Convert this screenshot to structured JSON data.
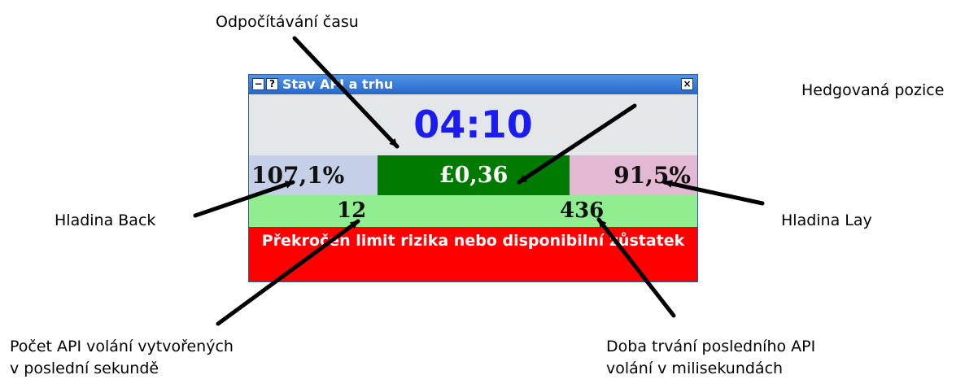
{
  "window": {
    "title": "Stav API a trhu",
    "minimize_glyph": "−",
    "help_glyph": "?",
    "close_glyph": "×",
    "icons": {
      "minimize": "minimize-icon",
      "help": "help-icon",
      "close": "close-icon"
    }
  },
  "market": {
    "countdown": "04:10",
    "back_level": "107,1%",
    "hedged_position": "£0,36",
    "lay_level": "91,5%",
    "api_calls_last_second": "12",
    "last_api_duration_ms": "436",
    "warning": "Překročen limit rizika nebo disponibilní zůstatek"
  },
  "colors": {
    "titlebar": "#2a6bd0",
    "timer_text": "#1c1cf0",
    "back_bg": "#c5d0e8",
    "hedge_bg": "#007a00",
    "lay_bg": "#e2b8d3",
    "api_bg": "#90ee90",
    "warning_bg": "#ff0000"
  },
  "callouts": {
    "countdown": "Odpočítávání času",
    "hedged_position": "Hedgovaná pozice",
    "back_level": "Hladina Back",
    "lay_level": "Hladina Lay",
    "api_calls_line1": "Počet API volání vytvořených",
    "api_calls_line2": "v poslední sekundě",
    "api_duration_line1": "Doba trvání posledního API",
    "api_duration_line2": "volání v milisekundách"
  }
}
